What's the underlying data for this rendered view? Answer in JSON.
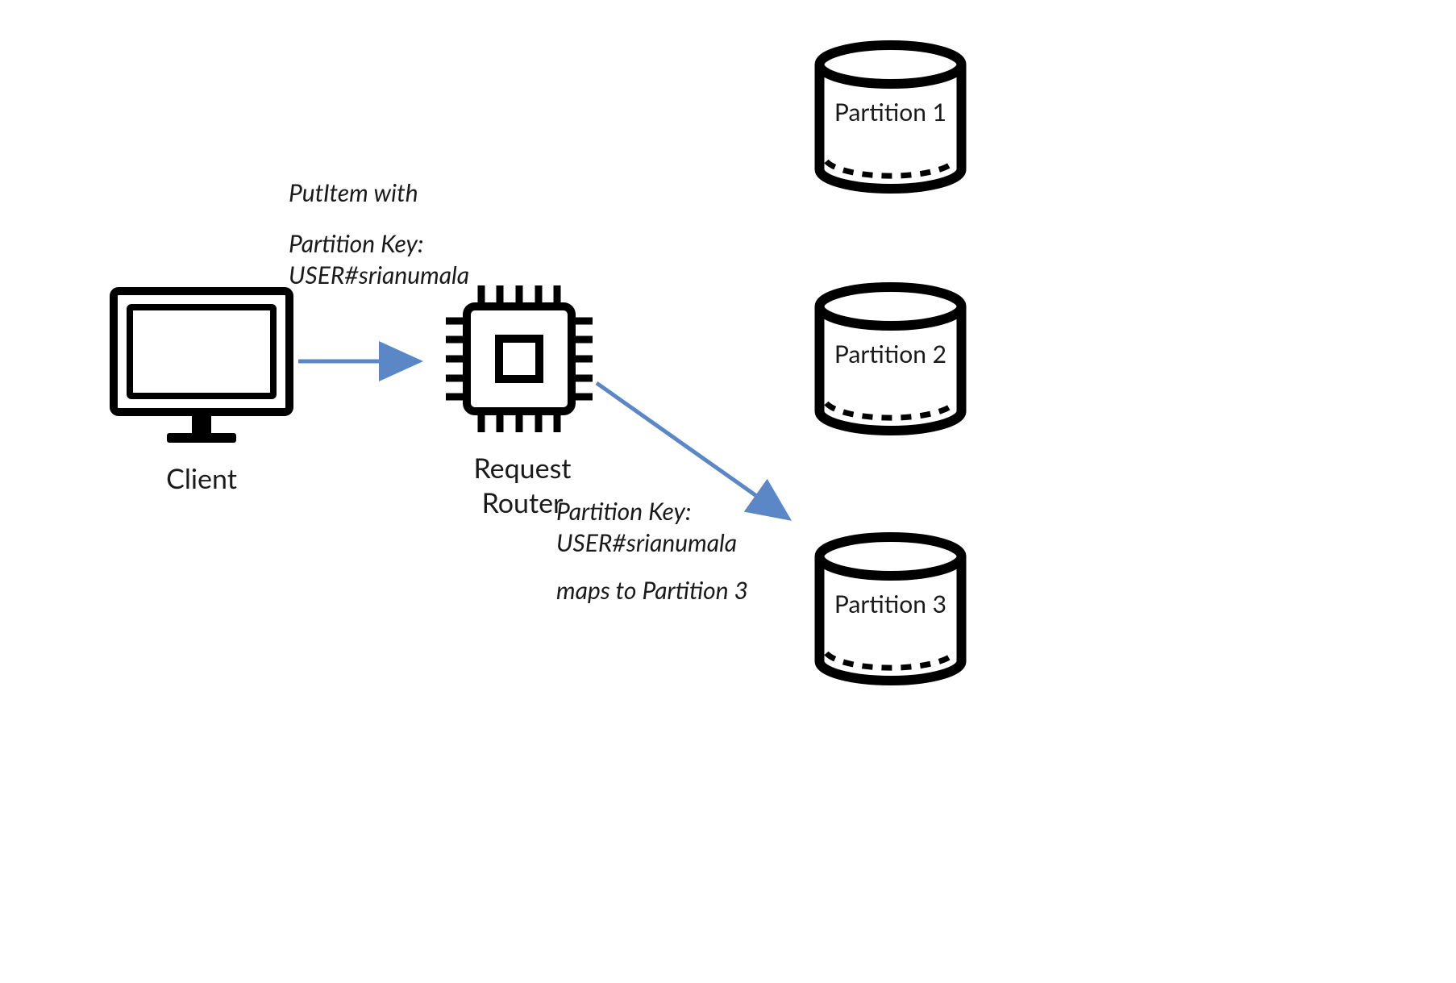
{
  "nodes": {
    "client_label": "Client",
    "router_label_line1": "Request",
    "router_label_line2": "Router",
    "partition1_label": "Partition 1",
    "partition2_label": "Partition 2",
    "partition3_label": "Partition 3"
  },
  "annotations": {
    "putitem_line1": "PutItem with",
    "putitem_line2": "Partition Key:",
    "putitem_line3": "USER#srianumala",
    "route_line1": "Partition Key:",
    "route_line2": "USER#srianumala",
    "route_line3": "maps to Partition 3"
  },
  "colors": {
    "arrow": "#5b87c7",
    "stroke": "#000000"
  }
}
